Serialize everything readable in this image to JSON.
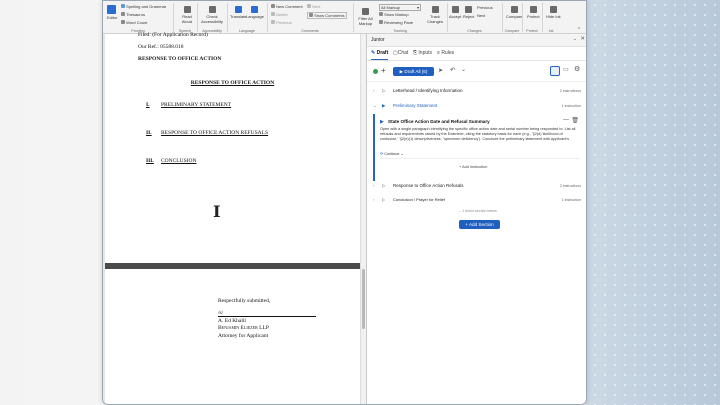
{
  "ribbon": {
    "proofing": {
      "spelling": "Spelling and Grammar",
      "thesaurus": "Thesaurus",
      "word_count": "Word Count",
      "editor": "Editor",
      "label": "Proofing"
    },
    "speech": {
      "read_aloud": "Read Aloud",
      "label": "Speech"
    },
    "accessibility": {
      "check": "Check Accessibility",
      "label": "Accessibility"
    },
    "language": {
      "translate": "Translate",
      "language": "Language",
      "label": "Language"
    },
    "comments": {
      "new_comment": "New Comment",
      "delete": "Delete",
      "previous": "Previous",
      "next": "Next",
      "show_comments": "Show Comments",
      "label": "Comments"
    },
    "tracking": {
      "all_markup": "All Markup",
      "show_markup": "Show Markup",
      "reviewing_pane": "Reviewing Pane",
      "track_changes": "Track Changes",
      "filter_all_markup": "Filter All Markup",
      "label": "Tracking"
    },
    "changes": {
      "accept": "Accept",
      "reject": "Reject",
      "previous": "Previous",
      "next": "Next",
      "label": "Changes"
    },
    "compare": {
      "compare": "Compare",
      "label": "Compare"
    },
    "protect": {
      "protect": "Protect",
      "label": "Protect"
    },
    "ink": {
      "hide_ink": "Hide Ink",
      "label": "Ink"
    }
  },
  "document": {
    "filed": "Filed: (For Application Record)",
    "our_ref": "Our Ref.: 05588.018",
    "response_label": "RESPONSE TO OFFICE ACTION",
    "heading": "RESPONSE TO OFFICE ACTION",
    "sections": [
      {
        "num": "I.",
        "title": "PRELIMINARY STATEMENT"
      },
      {
        "num": "II.",
        "title": "RESPONSE TO OFFICE ACTION REFUSALS"
      },
      {
        "num": "III.",
        "title": "CONCLUSION"
      }
    ],
    "closing": "Respectfully submitted,",
    "sig": "/s/",
    "name": "A. Ed Khalil",
    "firm": "Benjamin Eliezer LLP",
    "role": "Attorney for Applicant"
  },
  "pane": {
    "title": "Junior",
    "tabs": [
      "Draft",
      "Chat",
      "Inputs",
      "Rules"
    ],
    "draft_all": "Draft All (6)",
    "sections": [
      {
        "title": "Letterhead / Identifying Information",
        "count": "2 instructions"
      },
      {
        "title": "Preliminary Statement",
        "count": "1 instruction"
      },
      {
        "title": "Response to Office Action Refusals",
        "count": "2 instructions"
      },
      {
        "title": "Conclusion / Prayer for Relief",
        "count": "1 instruction"
      }
    ],
    "card": {
      "title": "State Office Action Date and Refusal Summary",
      "body": "Open with a single paragraph identifying the specific office action date and serial number being responded to. List all refusals and requirements raised by the Examiner, citing the statutory basis for each (e.g., '§2(d) likelihood of confusion,' '§2(e)(1) descriptiveness,' 'specimen deficiency'). Conclude the preliminary statement with Applicant's",
      "continue": "Continue",
      "add_instruction": "Add Instruction"
    },
    "minor_section": "1 minor section below",
    "add_section": "Add Section"
  }
}
